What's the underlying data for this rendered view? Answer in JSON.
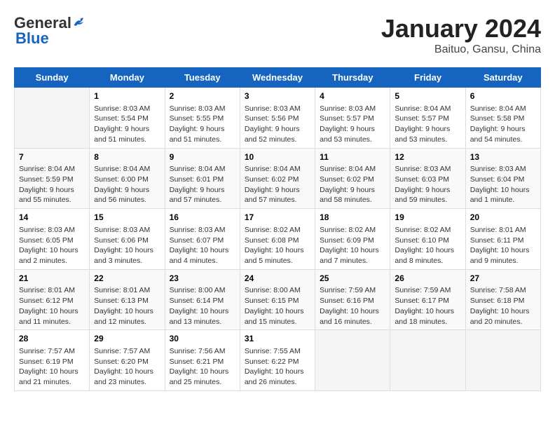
{
  "header": {
    "logo_general": "General",
    "logo_blue": "Blue",
    "title": "January 2024",
    "subtitle": "Baituo, Gansu, China"
  },
  "weekdays": [
    "Sunday",
    "Monday",
    "Tuesday",
    "Wednesday",
    "Thursday",
    "Friday",
    "Saturday"
  ],
  "weeks": [
    [
      {
        "day": "",
        "sunrise": "",
        "sunset": "",
        "daylight": ""
      },
      {
        "day": "1",
        "sunrise": "Sunrise: 8:03 AM",
        "sunset": "Sunset: 5:54 PM",
        "daylight": "Daylight: 9 hours and 51 minutes."
      },
      {
        "day": "2",
        "sunrise": "Sunrise: 8:03 AM",
        "sunset": "Sunset: 5:55 PM",
        "daylight": "Daylight: 9 hours and 51 minutes."
      },
      {
        "day": "3",
        "sunrise": "Sunrise: 8:03 AM",
        "sunset": "Sunset: 5:56 PM",
        "daylight": "Daylight: 9 hours and 52 minutes."
      },
      {
        "day": "4",
        "sunrise": "Sunrise: 8:03 AM",
        "sunset": "Sunset: 5:57 PM",
        "daylight": "Daylight: 9 hours and 53 minutes."
      },
      {
        "day": "5",
        "sunrise": "Sunrise: 8:04 AM",
        "sunset": "Sunset: 5:57 PM",
        "daylight": "Daylight: 9 hours and 53 minutes."
      },
      {
        "day": "6",
        "sunrise": "Sunrise: 8:04 AM",
        "sunset": "Sunset: 5:58 PM",
        "daylight": "Daylight: 9 hours and 54 minutes."
      }
    ],
    [
      {
        "day": "7",
        "sunrise": "Sunrise: 8:04 AM",
        "sunset": "Sunset: 5:59 PM",
        "daylight": "Daylight: 9 hours and 55 minutes."
      },
      {
        "day": "8",
        "sunrise": "Sunrise: 8:04 AM",
        "sunset": "Sunset: 6:00 PM",
        "daylight": "Daylight: 9 hours and 56 minutes."
      },
      {
        "day": "9",
        "sunrise": "Sunrise: 8:04 AM",
        "sunset": "Sunset: 6:01 PM",
        "daylight": "Daylight: 9 hours and 57 minutes."
      },
      {
        "day": "10",
        "sunrise": "Sunrise: 8:04 AM",
        "sunset": "Sunset: 6:02 PM",
        "daylight": "Daylight: 9 hours and 57 minutes."
      },
      {
        "day": "11",
        "sunrise": "Sunrise: 8:04 AM",
        "sunset": "Sunset: 6:02 PM",
        "daylight": "Daylight: 9 hours and 58 minutes."
      },
      {
        "day": "12",
        "sunrise": "Sunrise: 8:03 AM",
        "sunset": "Sunset: 6:03 PM",
        "daylight": "Daylight: 9 hours and 59 minutes."
      },
      {
        "day": "13",
        "sunrise": "Sunrise: 8:03 AM",
        "sunset": "Sunset: 6:04 PM",
        "daylight": "Daylight: 10 hours and 1 minute."
      }
    ],
    [
      {
        "day": "14",
        "sunrise": "Sunrise: 8:03 AM",
        "sunset": "Sunset: 6:05 PM",
        "daylight": "Daylight: 10 hours and 2 minutes."
      },
      {
        "day": "15",
        "sunrise": "Sunrise: 8:03 AM",
        "sunset": "Sunset: 6:06 PM",
        "daylight": "Daylight: 10 hours and 3 minutes."
      },
      {
        "day": "16",
        "sunrise": "Sunrise: 8:03 AM",
        "sunset": "Sunset: 6:07 PM",
        "daylight": "Daylight: 10 hours and 4 minutes."
      },
      {
        "day": "17",
        "sunrise": "Sunrise: 8:02 AM",
        "sunset": "Sunset: 6:08 PM",
        "daylight": "Daylight: 10 hours and 5 minutes."
      },
      {
        "day": "18",
        "sunrise": "Sunrise: 8:02 AM",
        "sunset": "Sunset: 6:09 PM",
        "daylight": "Daylight: 10 hours and 7 minutes."
      },
      {
        "day": "19",
        "sunrise": "Sunrise: 8:02 AM",
        "sunset": "Sunset: 6:10 PM",
        "daylight": "Daylight: 10 hours and 8 minutes."
      },
      {
        "day": "20",
        "sunrise": "Sunrise: 8:01 AM",
        "sunset": "Sunset: 6:11 PM",
        "daylight": "Daylight: 10 hours and 9 minutes."
      }
    ],
    [
      {
        "day": "21",
        "sunrise": "Sunrise: 8:01 AM",
        "sunset": "Sunset: 6:12 PM",
        "daylight": "Daylight: 10 hours and 11 minutes."
      },
      {
        "day": "22",
        "sunrise": "Sunrise: 8:01 AM",
        "sunset": "Sunset: 6:13 PM",
        "daylight": "Daylight: 10 hours and 12 minutes."
      },
      {
        "day": "23",
        "sunrise": "Sunrise: 8:00 AM",
        "sunset": "Sunset: 6:14 PM",
        "daylight": "Daylight: 10 hours and 13 minutes."
      },
      {
        "day": "24",
        "sunrise": "Sunrise: 8:00 AM",
        "sunset": "Sunset: 6:15 PM",
        "daylight": "Daylight: 10 hours and 15 minutes."
      },
      {
        "day": "25",
        "sunrise": "Sunrise: 7:59 AM",
        "sunset": "Sunset: 6:16 PM",
        "daylight": "Daylight: 10 hours and 16 minutes."
      },
      {
        "day": "26",
        "sunrise": "Sunrise: 7:59 AM",
        "sunset": "Sunset: 6:17 PM",
        "daylight": "Daylight: 10 hours and 18 minutes."
      },
      {
        "day": "27",
        "sunrise": "Sunrise: 7:58 AM",
        "sunset": "Sunset: 6:18 PM",
        "daylight": "Daylight: 10 hours and 20 minutes."
      }
    ],
    [
      {
        "day": "28",
        "sunrise": "Sunrise: 7:57 AM",
        "sunset": "Sunset: 6:19 PM",
        "daylight": "Daylight: 10 hours and 21 minutes."
      },
      {
        "day": "29",
        "sunrise": "Sunrise: 7:57 AM",
        "sunset": "Sunset: 6:20 PM",
        "daylight": "Daylight: 10 hours and 23 minutes."
      },
      {
        "day": "30",
        "sunrise": "Sunrise: 7:56 AM",
        "sunset": "Sunset: 6:21 PM",
        "daylight": "Daylight: 10 hours and 25 minutes."
      },
      {
        "day": "31",
        "sunrise": "Sunrise: 7:55 AM",
        "sunset": "Sunset: 6:22 PM",
        "daylight": "Daylight: 10 hours and 26 minutes."
      },
      {
        "day": "",
        "sunrise": "",
        "sunset": "",
        "daylight": ""
      },
      {
        "day": "",
        "sunrise": "",
        "sunset": "",
        "daylight": ""
      },
      {
        "day": "",
        "sunrise": "",
        "sunset": "",
        "daylight": ""
      }
    ]
  ]
}
